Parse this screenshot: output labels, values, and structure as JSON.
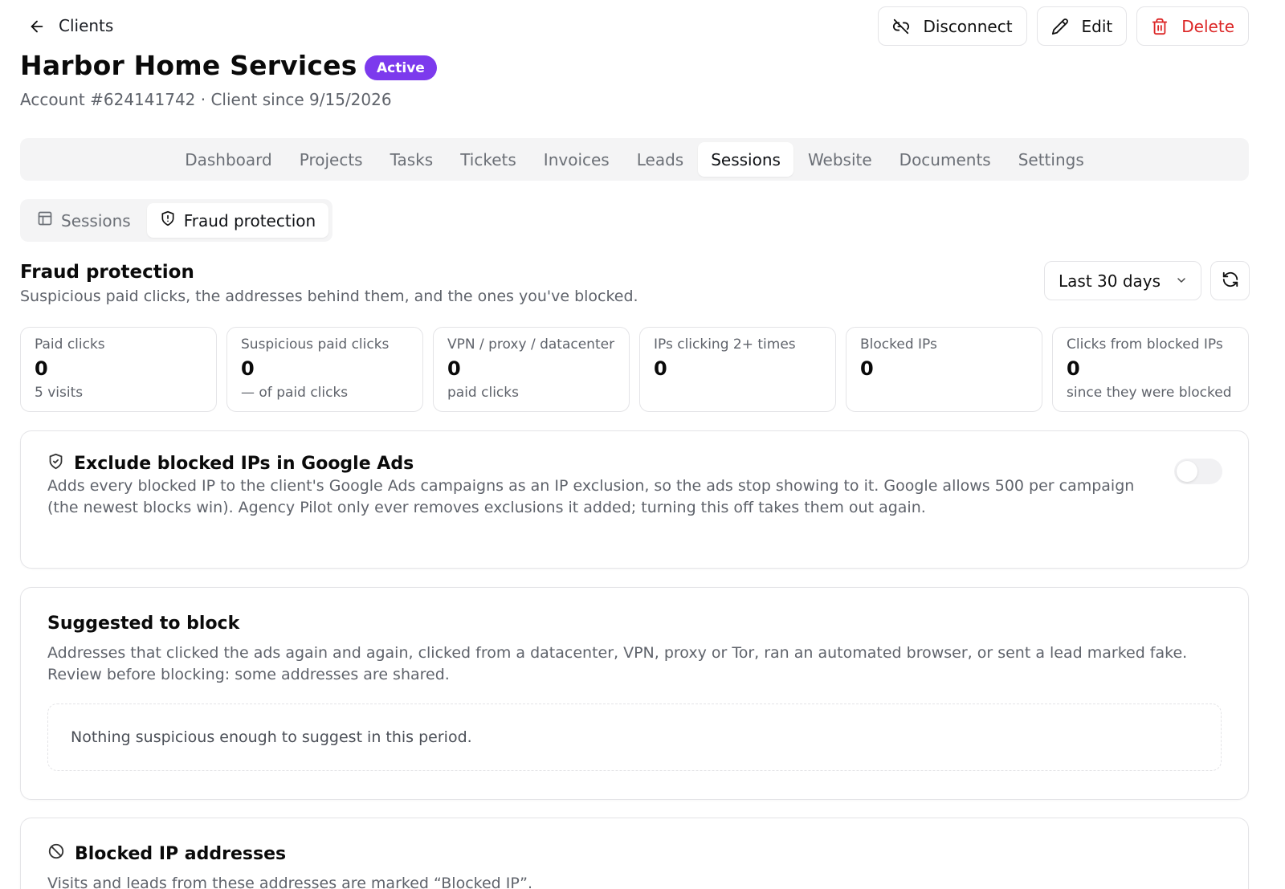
{
  "header": {
    "breadcrumb": "Clients",
    "title": "Harbor Home Services",
    "status_badge": "Active",
    "subtitle": "Account #624141742 · Client since 9/15/2026",
    "actions": {
      "disconnect": "Disconnect",
      "edit": "Edit",
      "delete": "Delete"
    }
  },
  "tabs": [
    {
      "label": "Dashboard"
    },
    {
      "label": "Projects"
    },
    {
      "label": "Tasks"
    },
    {
      "label": "Tickets"
    },
    {
      "label": "Invoices"
    },
    {
      "label": "Leads"
    },
    {
      "label": "Sessions",
      "active": true
    },
    {
      "label": "Website"
    },
    {
      "label": "Documents"
    },
    {
      "label": "Settings"
    }
  ],
  "subtabs": [
    {
      "label": "Sessions",
      "icon": "table-icon"
    },
    {
      "label": "Fraud protection",
      "icon": "shield-icon",
      "active": true
    }
  ],
  "section": {
    "title": "Fraud protection",
    "description": "Suspicious paid clicks, the addresses behind them, and the ones you've blocked.",
    "range_select": "Last 30 days"
  },
  "stats": [
    {
      "label": "Paid clicks",
      "value": "0",
      "note": "5 visits"
    },
    {
      "label": "Suspicious paid clicks",
      "value": "0",
      "note": "— of paid clicks"
    },
    {
      "label": "VPN / proxy / datacenter",
      "value": "0",
      "note": "paid clicks"
    },
    {
      "label": "IPs clicking 2+ times",
      "value": "0",
      "note": ""
    },
    {
      "label": "Blocked IPs",
      "value": "0",
      "note": ""
    },
    {
      "label": "Clicks from blocked IPs",
      "value": "0",
      "note": "since they were blocked"
    }
  ],
  "exclude_card": {
    "title": "Exclude blocked IPs in Google Ads",
    "text_line1": "Adds every blocked IP to the client's Google Ads campaigns as an IP exclusion, so the ads stop showing to it. Google allows 500 per campaign",
    "text_line2": "(the newest blocks win). Agency Pilot only ever removes exclusions it added; turning this off takes them out again.",
    "toggle_on": false
  },
  "suggested_card": {
    "title": "Suggested to block",
    "text_line1": "Addresses that clicked the ads again and again, clicked from a datacenter, VPN, proxy or Tor, ran an automated browser, or sent a lead marked fake.",
    "text_line2": "Review before blocking: some addresses are shared.",
    "empty": "Nothing suspicious enough to suggest in this period."
  },
  "blocked_card": {
    "title": "Blocked IP addresses",
    "text_line1": "Visits and leads from these addresses are marked “Blocked IP”."
  },
  "colors": {
    "accent": "#7c3aed",
    "danger": "#dc2626",
    "muted_text": "#5f636b",
    "border": "#e4e4e7"
  }
}
